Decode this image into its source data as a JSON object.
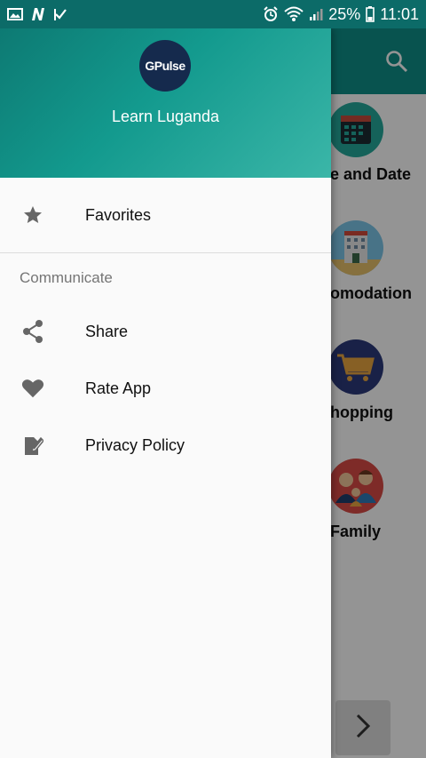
{
  "status_bar": {
    "battery": "25%",
    "time": "11:01"
  },
  "drawer": {
    "logo_text": "GPulse",
    "app_name": "Learn Luganda",
    "favorites_label": "Favorites",
    "section_title": "Communicate",
    "items": [
      {
        "label": "Share",
        "icon": "share-icon"
      },
      {
        "label": "Rate App",
        "icon": "heart-icon"
      },
      {
        "label": "Privacy Policy",
        "icon": "edit-document-icon"
      }
    ]
  },
  "background": {
    "categories": [
      "e and Date",
      "omodation",
      "hopping",
      "Family"
    ]
  },
  "colors": {
    "primary_dark": "#0c6b68",
    "primary": "#0f8f88",
    "accent_gradient_end": "#3bb6a8",
    "icon_gray": "#666666"
  }
}
